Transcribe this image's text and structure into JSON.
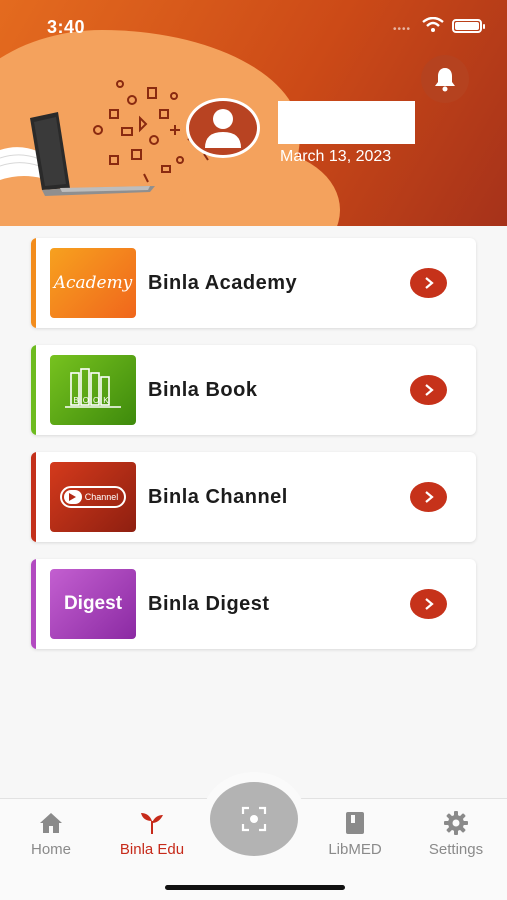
{
  "status_bar": {
    "time": "3:40"
  },
  "header": {
    "date": "March 13, 2023",
    "icons": {
      "notification": "bell-icon",
      "avatar": "user-avatar-icon"
    }
  },
  "cards": [
    {
      "title": "Binla Academy",
      "thumb_text": "Academy",
      "accent": "#f28c1c",
      "thumb_bg": "#f4801e",
      "icon": "academy-logo"
    },
    {
      "title": "Binla Book",
      "thumb_text": "BOOK",
      "accent": "#6dbb1f",
      "thumb_bg": "#4e9a12",
      "icon": "book-logo"
    },
    {
      "title": "Binla Channel",
      "thumb_text": "Channel",
      "accent": "#c3301a",
      "thumb_bg": "#b32a16",
      "icon": "channel-logo"
    },
    {
      "title": "Binla Digest",
      "thumb_text": "Digest",
      "accent": "#b24ac0",
      "thumb_bg": "#a53ab8",
      "icon": "digest-logo"
    }
  ],
  "tabbar": {
    "tabs": [
      {
        "label": "Home",
        "icon": "home-icon",
        "active": false
      },
      {
        "label": "Binla Edu",
        "icon": "sprout-icon",
        "active": true
      },
      {
        "label": "LibMED",
        "icon": "book-icon",
        "active": false
      },
      {
        "label": "Settings",
        "icon": "gear-icon",
        "active": false
      }
    ],
    "center_button_icon": "scan-icon"
  },
  "colors": {
    "accent": "#c6321a",
    "header_start": "#e46b1f",
    "header_end": "#a6321a"
  }
}
